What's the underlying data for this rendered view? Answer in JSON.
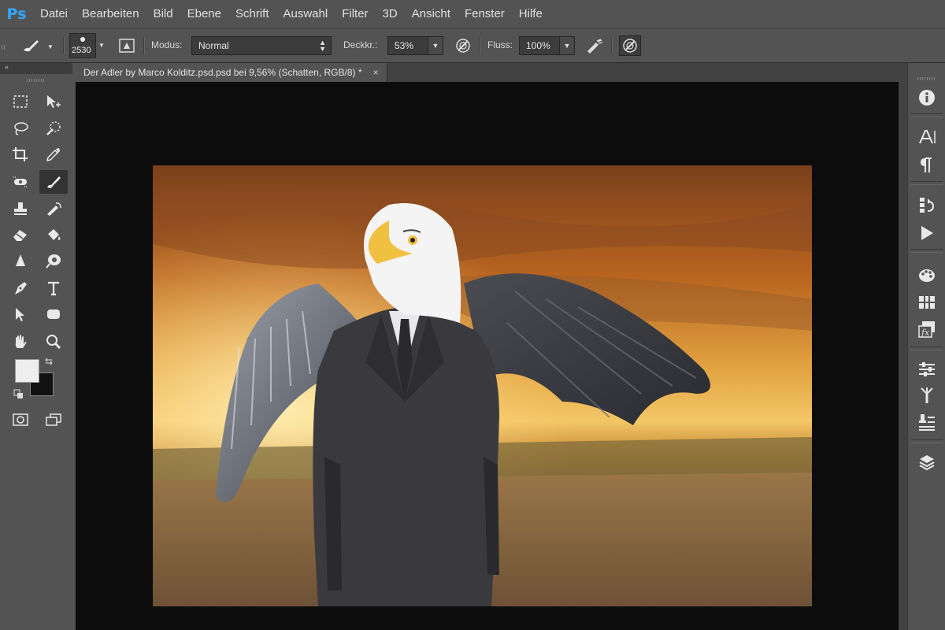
{
  "app": {
    "logo": "Ps"
  },
  "menu": [
    "Datei",
    "Bearbeiten",
    "Bild",
    "Ebene",
    "Schrift",
    "Auswahl",
    "Filter",
    "3D",
    "Ansicht",
    "Fenster",
    "Hilfe"
  ],
  "options": {
    "brush_size": "2530",
    "mode_label": "Modus:",
    "mode_value": "Normal",
    "opacity_label": "Deckkr.:",
    "opacity_value": "53%",
    "flow_label": "Fluss:",
    "flow_value": "100%"
  },
  "document": {
    "tab_title": "Der Adler by Marco Kolditz.psd.psd  bei 9,56% (Schatten, RGB/8) *",
    "close_glyph": "×"
  },
  "panel_collapse_glyph": "«",
  "colors": {
    "foreground": "#eeeeee",
    "background": "#111111",
    "accent": "#31a8ff"
  },
  "icons": {
    "tools": [
      "rect-marquee-icon",
      "move-icon",
      "lasso-icon",
      "quick-select-icon",
      "crop-icon",
      "eyedropper-icon",
      "spot-healing-icon",
      "brush-icon",
      "clone-stamp-icon",
      "history-brush-icon",
      "eraser-icon",
      "paint-bucket-icon",
      "blur-icon",
      "dodge-icon",
      "pen-icon",
      "type-icon",
      "path-select-icon",
      "shape-icon",
      "hand-icon",
      "zoom-icon"
    ],
    "right_panel": [
      "info-icon",
      "character-icon",
      "paragraph-icon",
      "history-icon",
      "actions-icon",
      "color-icon",
      "swatches-icon",
      "styles-icon",
      "adjustments-icon",
      "brush-presets-icon",
      "clone-source-icon",
      "layers-3d-icon"
    ]
  }
}
